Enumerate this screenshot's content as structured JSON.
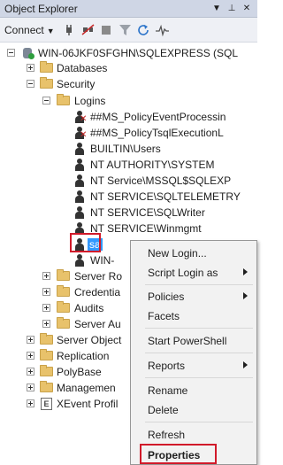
{
  "titlebar": {
    "title": "Object Explorer",
    "dropdown_glyph": "▼",
    "pin_glyph": "⊥",
    "close_glyph": "✕"
  },
  "toolbar": {
    "connect_label": "Connect",
    "connect_chevron": "▼"
  },
  "tree": {
    "server": "WIN-06JKF0SFGHN\\SQLEXPRESS (SQL",
    "databases": "Databases",
    "security": "Security",
    "logins": "Logins",
    "login_items": [
      "##MS_PolicyEventProcessin",
      "##MS_PolicyTsqlExecutionL",
      "BUILTIN\\Users",
      "NT AUTHORITY\\SYSTEM",
      "NT Service\\MSSQL$SQLEXP",
      "NT SERVICE\\SQLTELEMETRY",
      "NT SERVICE\\SQLWriter",
      "NT SERVICE\\Winmgmt",
      "sa",
      "WIN-"
    ],
    "security_children": [
      "Server Ro",
      "Credentia",
      "Audits",
      "Server Au"
    ],
    "root_children": [
      "Server Object",
      "Replication",
      "PolyBase",
      "Managemen",
      "XEvent Profil"
    ]
  },
  "context_menu": {
    "new_login": "New Login...",
    "script_login_as": "Script Login as",
    "policies": "Policies",
    "facets": "Facets",
    "start_powershell": "Start PowerShell",
    "reports": "Reports",
    "rename": "Rename",
    "delete": "Delete",
    "refresh": "Refresh",
    "properties": "Properties"
  },
  "colors": {
    "highlight": "#d11a2a",
    "selection": "#3399ff"
  },
  "icons": {
    "connect": "plug-icon",
    "filter": "filter-icon",
    "refresh": "refresh-icon",
    "activity": "activity-monitor-icon"
  }
}
